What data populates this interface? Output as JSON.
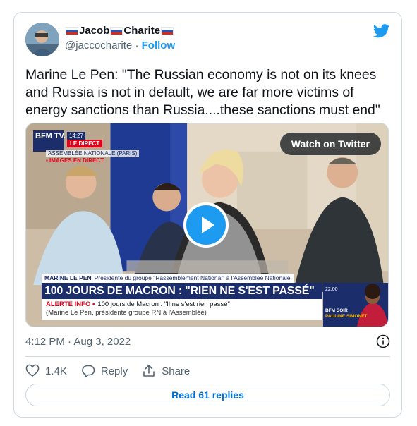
{
  "author": {
    "display_name": "Jacob",
    "display_name_suffix": "Charite",
    "handle": "@jaccocharite",
    "separator": "·",
    "follow_label": "Follow"
  },
  "tweet": {
    "text": "Marine Le Pen: \"The Russian economy is not on its knees and Russia is not in default, we are far more victims of energy sanctions than Russia....these sanctions must end\"",
    "timestamp": "4:12 PM · Aug 3, 2022"
  },
  "media": {
    "watch_label": "Watch on Twitter",
    "broadcast": {
      "channel_logo": "BFM TV.",
      "clock": "14:27",
      "live_tag": "LE DIRECT",
      "location": "ASSEMBLÉE NATIONALE (PARIS)",
      "direct_label": "▪ IMAGES EN DIRECT",
      "speaker_name": "MARINE LE PEN",
      "speaker_title": "Présidente du groupe \"Rassemblement National\" à l'Assemblée Nationale",
      "headline": "100 JOURS DE MACRON : \"RIEN NE S'EST PASSÉ\"",
      "alert_label": "ALERTE INFO •",
      "alert_text": "100 jours de Macron : \"Il ne s'est rien passé\"",
      "alert_subtext": "(Marine Le Pen, présidente groupe RN à l'Assemblée)",
      "inset_time": "22:00",
      "inset_show": "BFM SOIR",
      "inset_host": "PAULINE SIMONET"
    }
  },
  "actions": {
    "like_count": "1.4K",
    "reply_label": "Reply",
    "share_label": "Share"
  },
  "footer": {
    "read_replies_label": "Read 61 replies"
  },
  "colors": {
    "accent": "#1d9bf0",
    "text_secondary": "#536471",
    "border": "#cfd9de",
    "broadcast_blue": "#1b2d6b",
    "broadcast_red": "#e2001a"
  },
  "icons": [
    "twitter-bird-icon",
    "play-icon",
    "info-icon",
    "heart-icon",
    "reply-icon",
    "share-icon",
    "russian-flag-icon"
  ]
}
